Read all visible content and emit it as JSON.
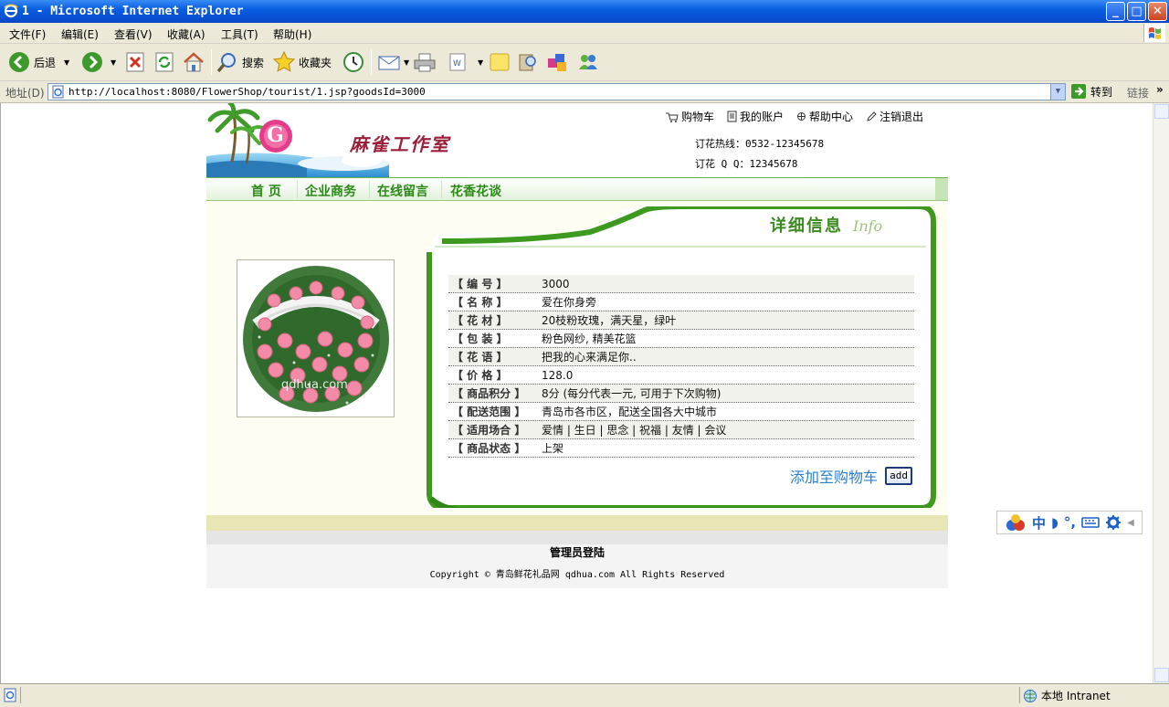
{
  "window": {
    "title": "1 - Microsoft Internet Explorer",
    "min": "_",
    "max": "□",
    "close": "✕"
  },
  "menu": {
    "items": [
      "文件(F)",
      "编辑(E)",
      "查看(V)",
      "收藏(A)",
      "工具(T)",
      "帮助(H)"
    ]
  },
  "toolbar": {
    "back": "后退",
    "search": "搜索",
    "favorites": "收藏夹"
  },
  "address": {
    "label": "地址(D)",
    "url": "http://localhost:8080/FlowerShop/tourist/1.jsp?goodsId=3000",
    "go": "转到",
    "links": "链接",
    "more": "»"
  },
  "site": {
    "brand": "麻雀工作室",
    "logo_letter": "G",
    "toplinks": [
      "购物车",
      "我的账户",
      "帮助中心",
      "注销退出"
    ],
    "hotline": "订花热线：0532-12345678",
    "qq": "订花 Q Q：12345678",
    "nav": [
      "首 页",
      "企业商务",
      "在线留言",
      "花香花谈"
    ],
    "panel_title": "详细信息",
    "panel_subtitle": "Info",
    "photo_watermark": "qdhua.com",
    "details": [
      {
        "key": "【 编  号 】",
        "value": "3000"
      },
      {
        "key": "【 名  称 】",
        "value": "爱在你身旁"
      },
      {
        "key": "【 花  材 】",
        "value": "20枝粉玫瑰，满天星，绿叶"
      },
      {
        "key": "【 包  装 】",
        "value": "粉色网纱, 精美花篮"
      },
      {
        "key": "【 花  语 】",
        "value": "把我的心来满足你.."
      },
      {
        "key": "【 价  格 】",
        "value": "128.0"
      },
      {
        "key": "【 商品积分 】",
        "value": "8分 (每分代表一元, 可用于下次购物)"
      },
      {
        "key": "【 配送范围 】",
        "value": "青岛市各市区，配送全国各大中城市"
      },
      {
        "key": "【 适用场合 】",
        "value": "爱情 | 生日 | 思念 | 祝福 | 友情 | 会议"
      },
      {
        "key": "【 商品状态 】",
        "value": "上架"
      }
    ],
    "add_to_cart": "添加至购物车",
    "add_button": "add",
    "admin_login": "管理员登陆",
    "copyright": "Copyright © 青岛鲜花礼品网 qdhua.com All Rights Reserved"
  },
  "ime": {
    "mode": "中",
    "half": "◗",
    "punct": "°,"
  },
  "status": {
    "zone": "本地 Intranet"
  },
  "colors": {
    "title_blue": "#0a5ee0",
    "chrome": "#ece9d8",
    "site_green": "#2a8a16",
    "link_blue": "#2a7fc6"
  }
}
